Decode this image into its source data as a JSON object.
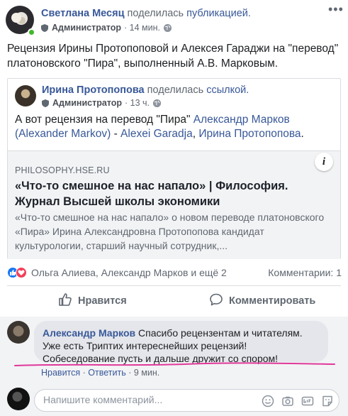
{
  "post": {
    "author": "Светлана Месяц",
    "action_text": "поделилась",
    "action_link": "публикацией.",
    "role": "Администратор",
    "time": "· 14 мин.",
    "text": "Рецензия Ирины Протопоповой и Алексея Гараджи на \"перевод\" платоновского \"Пира\", выполненный А.В. Марковым."
  },
  "shared": {
    "author": "Ирина Протопопова",
    "action_text": "поделилась",
    "action_link": "ссылкой.",
    "role": "Администратор",
    "time": "· 13 ч.",
    "text_prefix": "А вот рецензия на перевод \"Пира\"",
    "tag1": "Александр Марков (Alexander Markov)",
    "sep1": "-",
    "tag2": "Alexei Garadja",
    "sep2": ",",
    "tag3": "Ирина Протопопова",
    "end": "."
  },
  "link_card": {
    "domain": "PHILOSOPHY.HSE.RU",
    "title": "«Что-то смешное на нас напало» | Философия. Журнал Высшей школы экономики",
    "description": "«Что-то смешное на нас напало» о новом переводе платоновского «Пира» Ирина Александровна Протопопова кандидат культурологии, старший научный сотрудник,..."
  },
  "reactions": {
    "names": "Ольга Алиева, Александр Марков и ещё 2",
    "comments_count": "Комментарии: 1"
  },
  "actions": {
    "like": "Нравится",
    "comment": "Комментировать"
  },
  "comment": {
    "author": "Александр Марков",
    "text": "Спасибо рецензентам и читателям. Уже есть Триптих интереснейших рецензий! Собеседование пусть и дальше дружит со спором!",
    "like_action": "Нравится",
    "reply_action": "Ответить",
    "time": "· 9 мин."
  },
  "composer": {
    "placeholder": "Напишите комментарий..."
  },
  "colors": {
    "link": "#385898",
    "like_blue": "#1877f2",
    "love_red": "#f33e58",
    "online_green": "#42b72a",
    "highlight_pink": "#e0389a"
  }
}
